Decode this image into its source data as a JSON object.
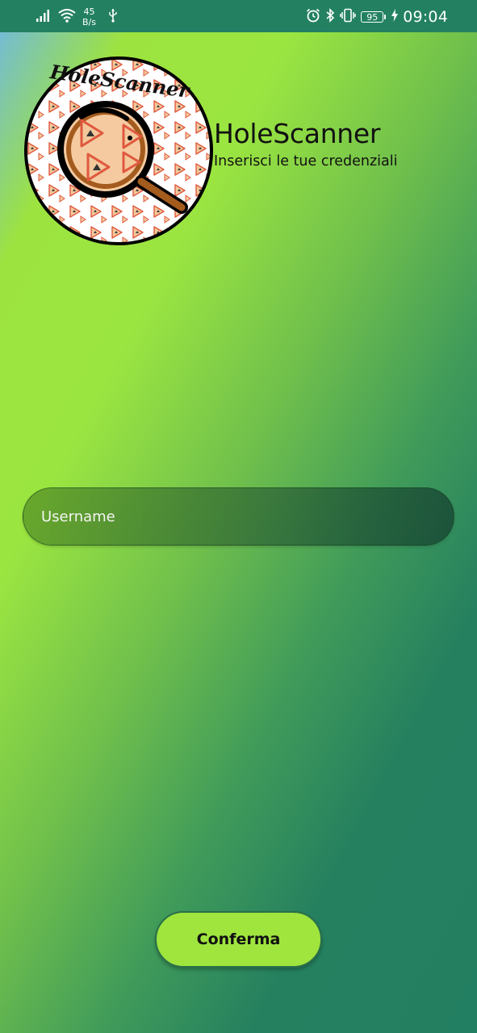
{
  "status_bar": {
    "net_speed_value": "45",
    "net_speed_unit": "B/s",
    "battery_level": "95",
    "time": "09:04",
    "icons": [
      "signal-icon",
      "wifi-icon",
      "usb-icon",
      "alarm-icon",
      "bluetooth-icon",
      "vibrate-icon",
      "battery-icon",
      "charging-icon"
    ]
  },
  "header": {
    "title": "HoleScanner",
    "subtitle": "Inserisci le tue credenziali",
    "logo_text": "HoleScanner"
  },
  "form": {
    "username_placeholder": "Username",
    "username_value": "",
    "confirm_label": "Conferma"
  },
  "colors": {
    "status_bar": "#238162",
    "accent_green": "#9fe53e",
    "dark_green": "#237f61"
  }
}
